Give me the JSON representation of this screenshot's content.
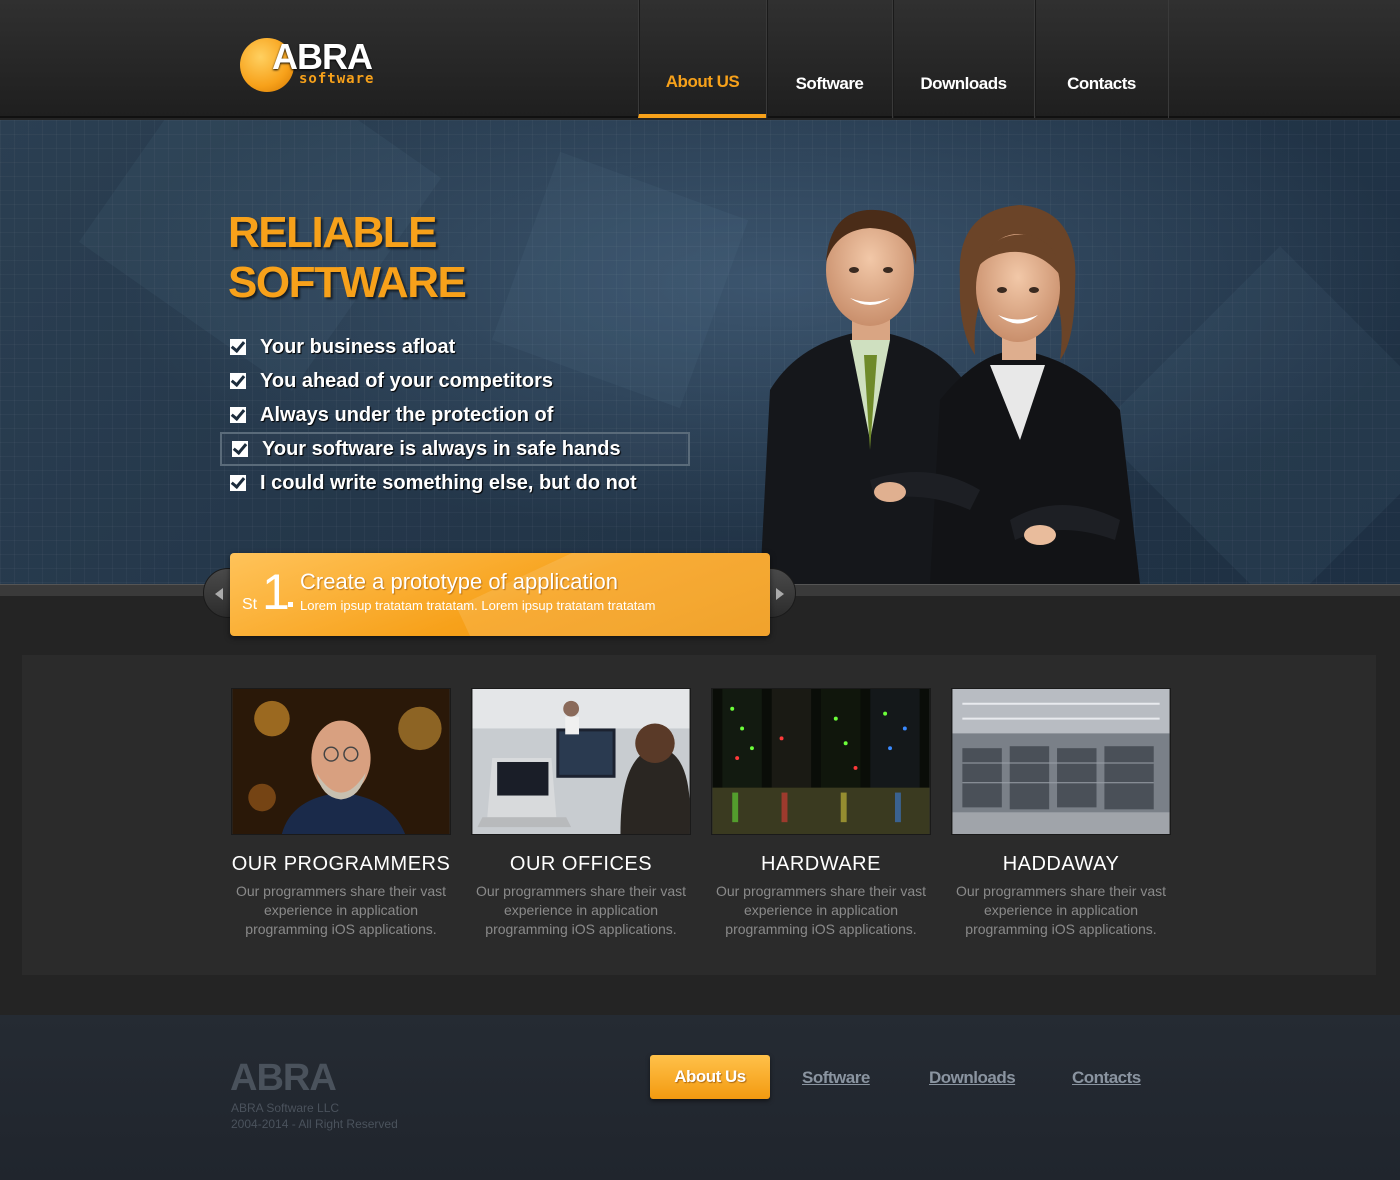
{
  "brand": {
    "name": "ABRA",
    "sub": "software"
  },
  "nav": {
    "items": [
      {
        "label": "About US",
        "active": true
      },
      {
        "label": "Software",
        "active": false
      },
      {
        "label": "Downloads",
        "active": false
      },
      {
        "label": "Contacts",
        "active": false
      }
    ]
  },
  "hero": {
    "title_line1": "RELIABLE",
    "title_line2": "SOFTWARE",
    "items": [
      "Your business afloat",
      "You ahead of your competitors",
      "Always under the protection of",
      "Your software is always in safe hands",
      "I could write something else, but do not"
    ],
    "selected_index": 3
  },
  "slide": {
    "prefix": "St",
    "number": "1",
    "title": "Create a prototype of application",
    "subtitle": "Lorem ipsup tratatam tratatam. Lorem ipsup tratatam tratatam"
  },
  "features": [
    {
      "title": "OUR PROGRAMMERS",
      "desc": "Our programmers share their vast experience in application programming iOS applications."
    },
    {
      "title": "OUR OFFICES",
      "desc": "Our programmers share their vast experience in application programming iOS applications."
    },
    {
      "title": "HARDWARE",
      "desc": "Our programmers share their vast experience in application programming iOS applications."
    },
    {
      "title": "HADDAWAY",
      "desc": "Our programmers share their vast experience in application programming iOS applications."
    }
  ],
  "footer": {
    "logo": "ABRA",
    "company": "ABRA Software LLC",
    "copyright": "2004-2014 - All Right Reserved",
    "button": "About Us",
    "links": [
      "Software",
      "Downloads",
      "Contacts"
    ]
  },
  "colors": {
    "accent": "#f7a11a",
    "hero_bg": "#24374a",
    "page_bg": "#242424",
    "footer_bg": "#232830"
  }
}
